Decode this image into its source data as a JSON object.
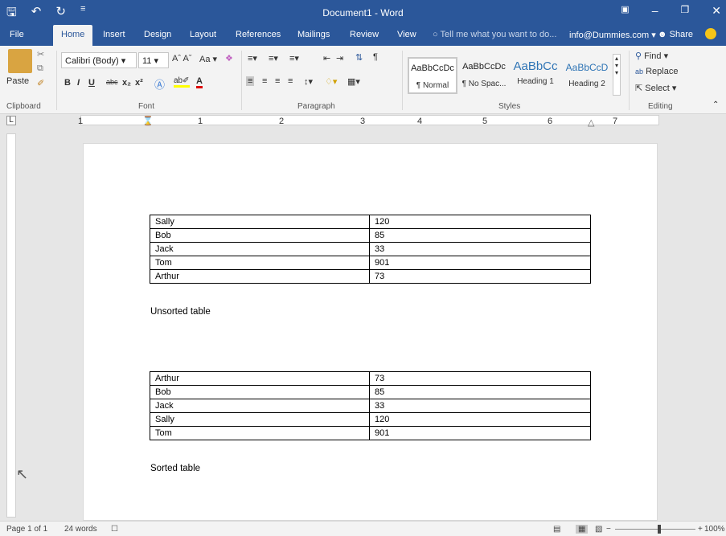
{
  "titlebar": {
    "title": "Document1 - Word",
    "save_icon": "floppy-disk-icon",
    "undo_icon": "undo-arrow-icon",
    "redo_icon": "redo-arrow-icon",
    "customize_icon": "customize-qat-icon"
  },
  "tabs": [
    {
      "label": "File"
    },
    {
      "label": "Home"
    },
    {
      "label": "Insert"
    },
    {
      "label": "Design"
    },
    {
      "label": "Layout"
    },
    {
      "label": "References"
    },
    {
      "label": "Mailings"
    },
    {
      "label": "Review"
    },
    {
      "label": "View"
    }
  ],
  "tellme": "Tell me what you want to do...",
  "account": "info@Dummies.com",
  "share": "Share",
  "ribbon": {
    "clipboard": {
      "paste": "Paste",
      "label": "Clipboard"
    },
    "font": {
      "name": "Calibri (Body)",
      "size": "11",
      "label": "Font",
      "case": "Aa"
    },
    "paragraph": {
      "label": "Paragraph"
    },
    "styles": {
      "label": "Styles",
      "items": [
        {
          "sample": "AaBbCcDc",
          "name": "¶ Normal"
        },
        {
          "sample": "AaBbCcDc",
          "name": "¶ No Spac..."
        },
        {
          "sample": "AaBbCc",
          "name": "Heading 1"
        },
        {
          "sample": "AaBbCcD",
          "name": "Heading 2"
        }
      ]
    },
    "editing": {
      "find": "Find",
      "replace": "Replace",
      "select": "Select",
      "label": "Editing"
    }
  },
  "ruler_numbers": [
    "1",
    "1",
    "2",
    "3",
    "4",
    "5",
    "6",
    "7"
  ],
  "document": {
    "unsorted": {
      "rows": [
        [
          "Sally",
          "120"
        ],
        [
          "Bob",
          "85"
        ],
        [
          "Jack",
          "33"
        ],
        [
          "Tom",
          "901"
        ],
        [
          "Arthur",
          "73"
        ]
      ],
      "caption": "Unsorted table"
    },
    "sorted": {
      "rows": [
        [
          "Arthur",
          "73"
        ],
        [
          "Bob",
          "85"
        ],
        [
          "Jack",
          "33"
        ],
        [
          "Sally",
          "120"
        ],
        [
          "Tom",
          "901"
        ]
      ],
      "caption": "Sorted table"
    }
  },
  "status": {
    "page": "Page 1 of 1",
    "words": "24 words",
    "zoom": "100%"
  },
  "colors": {
    "accent": "#2b579a",
    "smiley": "#f5c518"
  }
}
